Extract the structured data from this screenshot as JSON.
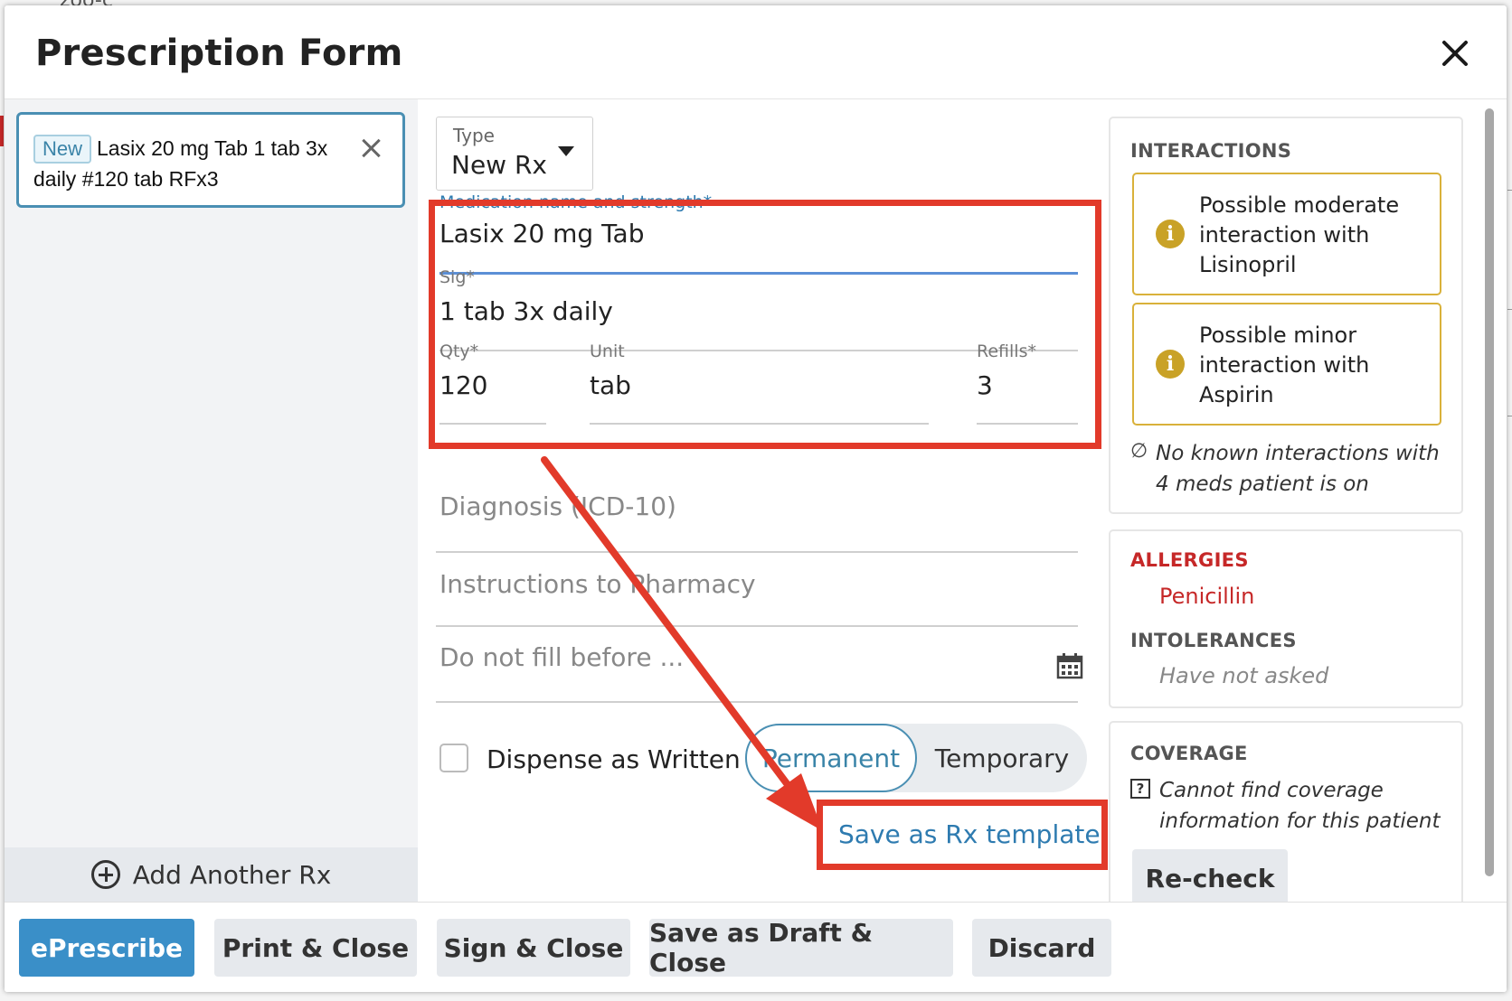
{
  "background": {
    "partial_text": "zoo-c"
  },
  "dialog": {
    "title": "Prescription Form"
  },
  "rx_list": {
    "items": [
      {
        "badge": "New",
        "summary": "Lasix 20 mg Tab 1 tab 3x daily #120 tab RFx3"
      }
    ],
    "add_label": "Add Another Rx"
  },
  "form": {
    "type": {
      "label": "Type",
      "value": "New Rx"
    },
    "medication": {
      "label": "Medication name and strength*",
      "value": "Lasix 20 mg Tab"
    },
    "sig": {
      "label": "Sig*",
      "value": "1 tab 3x daily"
    },
    "qty": {
      "label": "Qty*",
      "value": "120"
    },
    "unit": {
      "label": "Unit",
      "value": "tab"
    },
    "refills": {
      "label": "Refills*",
      "value": "3"
    },
    "diagnosis_placeholder": "Diagnosis (ICD-10)",
    "instructions_placeholder": "Instructions to Pharmacy",
    "do_not_fill_placeholder": "Do not fill before ...",
    "dispense_as_written": "Dispense as Written",
    "toggle": {
      "selected": "Permanent",
      "other": "Temporary"
    },
    "save_template": "Save as Rx template"
  },
  "interactions": {
    "heading": "INTERACTIONS",
    "warnings": [
      "Possible moderate interaction with Lisinopril",
      "Possible minor interaction with Aspirin"
    ],
    "note_symbol": "∅",
    "note": "No known interactions with 4 meds patient is on"
  },
  "allergies": {
    "heading": "ALLERGIES",
    "items": [
      "Penicillin"
    ],
    "intolerances_heading": "INTOLERANCES",
    "intolerances_note": "Have not asked"
  },
  "coverage": {
    "heading": "COVERAGE",
    "note_symbol": "?",
    "note": "Cannot find coverage information for this patient",
    "recheck": "Re-check"
  },
  "footer": {
    "eprescribe": "ePrescribe",
    "print_close": "Print & Close",
    "sign_close": "Sign & Close",
    "save_draft_close": "Save as Draft & Close",
    "discard": "Discard"
  },
  "colors": {
    "primary": "#3a8fc8",
    "accent": "#3a84a8",
    "warning_border": "#d9b13a",
    "allergy_red": "#c62828",
    "annotation_red": "#e23a2a"
  },
  "icons": {
    "close": "close-icon",
    "remove": "close-icon",
    "add": "plus-circle-icon",
    "dropdown": "caret-down-icon",
    "calendar": "calendar-icon",
    "info": "info-icon",
    "none": "empty-set-icon",
    "help": "question-box-icon"
  }
}
